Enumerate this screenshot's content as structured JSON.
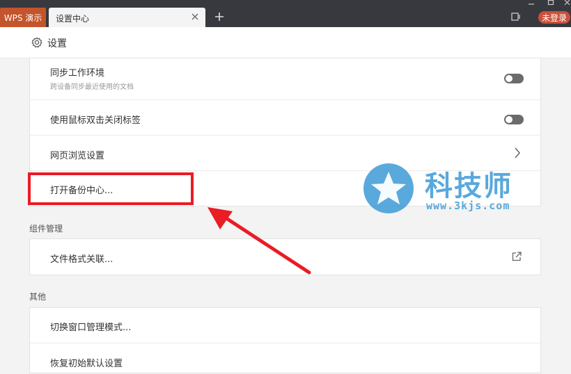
{
  "titlebar": {
    "app_tab": "WPS 演示",
    "active_tab": "设置中心",
    "login_button": "未登录"
  },
  "header": {
    "title": "设置"
  },
  "general": {
    "rows": [
      {
        "label": "同步工作环境",
        "sub": "跨设备同步最近使用的文档",
        "control": "toggle",
        "state": "off"
      },
      {
        "label": "使用鼠标双击关闭标签",
        "control": "toggle",
        "state": "off"
      },
      {
        "label": "网页浏览设置",
        "control": "chevron-right-icon"
      },
      {
        "label": "打开备份中心..."
      }
    ]
  },
  "components": {
    "section_title": "组件管理",
    "rows": [
      {
        "label": "文件格式关联...",
        "control": "external-link-icon"
      }
    ]
  },
  "other": {
    "section_title": "其他",
    "rows": [
      {
        "label": "切换窗口管理模式..."
      },
      {
        "label": "恢复初始默认设置"
      }
    ]
  },
  "watermark": {
    "brand": "科技师",
    "url": "www.3kjs.com"
  },
  "colors": {
    "app_tab": "#c4542b",
    "login": "#c9503a",
    "highlight": "#ea1c24",
    "watermark": "#3d9ad6"
  }
}
